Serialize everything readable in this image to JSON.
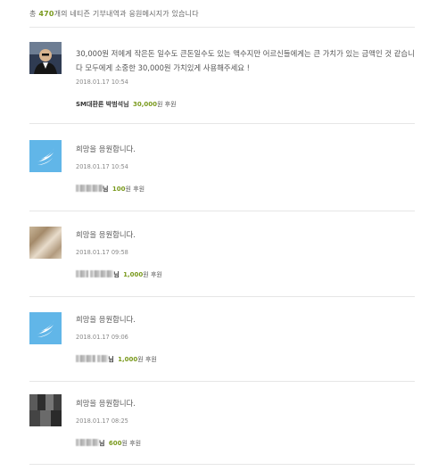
{
  "summary": {
    "prefix": "총 ",
    "count": "470",
    "suffix": "개의 네티즌 기부내역과 응원메시지가 있습니다"
  },
  "entries": [
    {
      "avatar": "photo",
      "message": "30,000원 저에게 작은돈 일수도 큰돈일수도 있는 액수지만 어르신들에게는 큰 가치가 있는 금액인 것 같습니다 모두에게 소중한 30,000원 가치있게 사용해주세요 !",
      "date": "2018.01.17 10:54",
      "donor_name": "SM대환론 박범석님",
      "amount": "30,000",
      "amount_suffix": "원 후원"
    },
    {
      "avatar": "wing",
      "message": "희망을 응원합니다.",
      "date": "2018.01.17 10:54",
      "donor_name": "님",
      "amount": "100",
      "amount_suffix": "원 후원"
    },
    {
      "avatar": "blur1",
      "message": "희망을 응원합니다.",
      "date": "2018.01.17 09:58",
      "donor_name": "님",
      "amount": "1,000",
      "amount_suffix": "원 후원"
    },
    {
      "avatar": "wing",
      "message": "희망을 응원합니다.",
      "date": "2018.01.17 09:06",
      "donor_name": "님",
      "amount": "1,000",
      "amount_suffix": "원 후원"
    },
    {
      "avatar": "blur2",
      "message": "희망을 응원합니다.",
      "date": "2018.01.17 08:25",
      "donor_name": "님",
      "amount": "600",
      "amount_suffix": "원 후원"
    }
  ]
}
